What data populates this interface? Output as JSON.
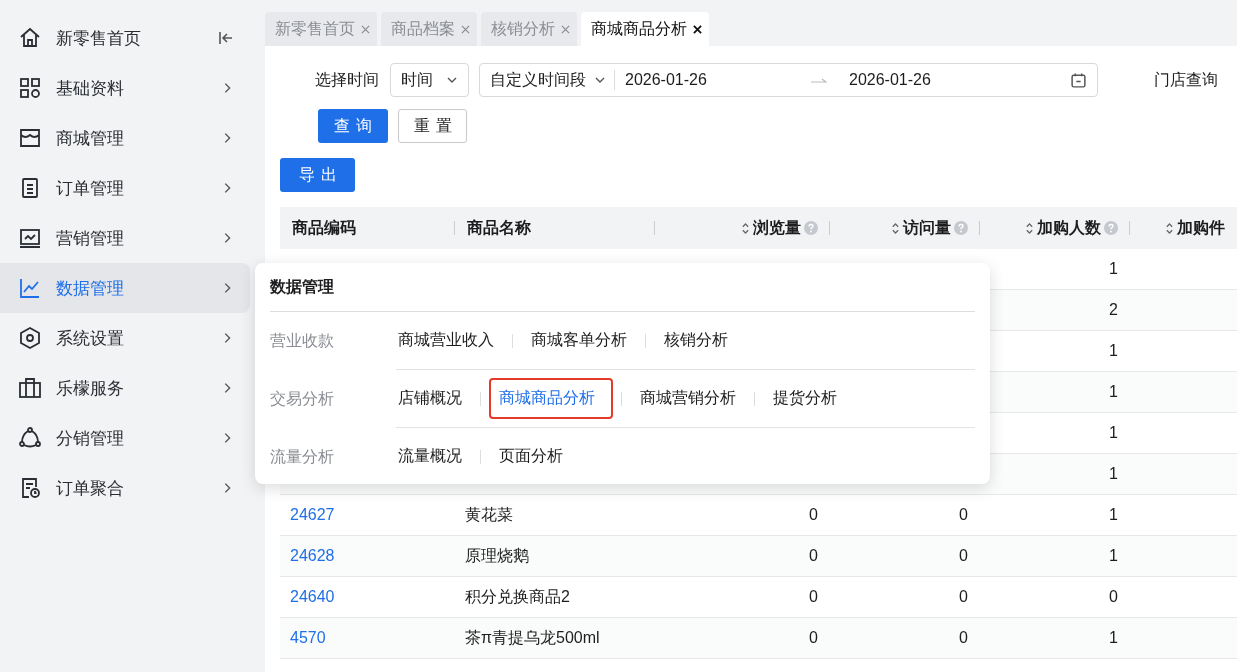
{
  "sidebar": {
    "items": [
      {
        "label": "新零售首页",
        "kind": "home",
        "selected": false
      },
      {
        "label": "基础资料",
        "kind": "submenu",
        "selected": false
      },
      {
        "label": "商城管理",
        "kind": "submenu",
        "selected": false
      },
      {
        "label": "订单管理",
        "kind": "submenu",
        "selected": false
      },
      {
        "label": "营销管理",
        "kind": "submenu",
        "selected": false
      },
      {
        "label": "数据管理",
        "kind": "submenu",
        "selected": true
      },
      {
        "label": "系统设置",
        "kind": "submenu",
        "selected": false
      },
      {
        "label": "乐檬服务",
        "kind": "submenu",
        "selected": false
      },
      {
        "label": "分销管理",
        "kind": "submenu",
        "selected": false
      },
      {
        "label": "订单聚合",
        "kind": "submenu",
        "selected": false
      }
    ]
  },
  "tabs": [
    {
      "label": "新零售首页",
      "selected": false
    },
    {
      "label": "商品档案",
      "selected": false
    },
    {
      "label": "核销分析",
      "selected": false
    },
    {
      "label": "商城商品分析",
      "selected": true
    }
  ],
  "filters": {
    "time_label": "选择时间",
    "mode_select": "时间",
    "range_type": "自定义时间段",
    "start_date": "2026-01-26",
    "end_date": "2026-01-26",
    "store_label": "门店查询"
  },
  "buttons": {
    "query": "查询",
    "reset": "重置",
    "export": "导出"
  },
  "table": {
    "columns": [
      {
        "label": "商品编码",
        "kind": "text"
      },
      {
        "label": "商品名称",
        "kind": "text"
      },
      {
        "label": "浏览量",
        "kind": "metric"
      },
      {
        "label": "访问量",
        "kind": "metric"
      },
      {
        "label": "加购人数",
        "kind": "metric"
      },
      {
        "label": "加购件",
        "kind": "sortable"
      }
    ],
    "rows": [
      {
        "cart_users": "1"
      },
      {
        "cart_users": "2"
      },
      {
        "cart_users": "1"
      },
      {
        "cart_users": "1"
      },
      {
        "cart_users": "1"
      },
      {
        "cart_users": "1"
      },
      {
        "code": "24627",
        "name": "黄花菜",
        "views": "0",
        "visits": "0",
        "cart_users": "1"
      },
      {
        "code": "24628",
        "name": "原理烧鹅",
        "views": "0",
        "visits": "0",
        "cart_users": "1"
      },
      {
        "code": "24640",
        "name": "积分兑换商品2",
        "views": "0",
        "visits": "0",
        "cart_users": "0"
      },
      {
        "code": "4570",
        "name": "茶π青提乌龙500ml",
        "views": "0",
        "visits": "0",
        "cart_users": "1"
      }
    ]
  },
  "flyout": {
    "title": "数据管理",
    "groups": [
      {
        "label": "营业收款",
        "links": [
          {
            "label": "商城营业收入",
            "selected": false
          },
          {
            "label": "商城客单分析",
            "selected": false
          },
          {
            "label": "核销分析",
            "selected": false
          }
        ]
      },
      {
        "label": "交易分析",
        "links": [
          {
            "label": "店铺概况",
            "selected": false
          },
          {
            "label": "商城商品分析",
            "selected": true
          },
          {
            "label": "商城营销分析",
            "selected": false
          },
          {
            "label": "提货分析",
            "selected": false
          }
        ]
      },
      {
        "label": "流量分析",
        "links": [
          {
            "label": "流量概况",
            "selected": false
          },
          {
            "label": "页面分析",
            "selected": false
          }
        ]
      }
    ]
  }
}
